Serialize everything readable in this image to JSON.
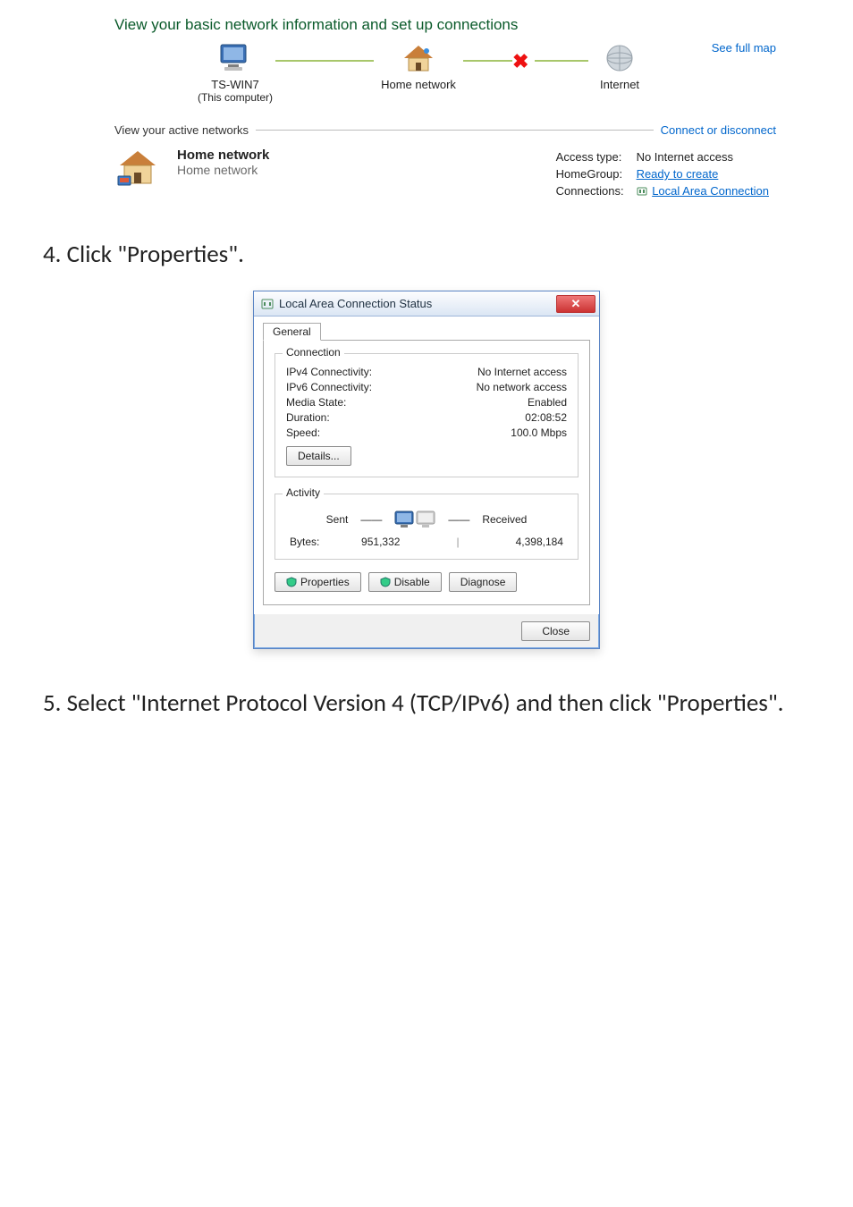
{
  "nsc": {
    "title": "View your basic network information and set up connections",
    "see_full_map": "See full map",
    "node_this_name": "TS-WIN7",
    "node_this_sub": "(This computer)",
    "node_home_label": "Home network",
    "node_internet_label": "Internet",
    "section_view_active": "View your active networks",
    "connect_disconnect": "Connect or disconnect",
    "home_network_name": "Home network",
    "home_network_type": "Home network",
    "access_type_label": "Access type:",
    "access_type_value": "No Internet access",
    "homegroup_label": "HomeGroup:",
    "homegroup_value": "Ready to create",
    "connections_label": "Connections:",
    "connections_value": "Local Area Connection"
  },
  "step4": "4. Click \"Properties\".",
  "dialog": {
    "title": "Local Area Connection Status",
    "tab_general": "General",
    "group_connection": "Connection",
    "ipv4_label": "IPv4 Connectivity:",
    "ipv4_value": "No Internet access",
    "ipv6_label": "IPv6 Connectivity:",
    "ipv6_value": "No network access",
    "media_label": "Media State:",
    "media_value": "Enabled",
    "duration_label": "Duration:",
    "duration_value": "02:08:52",
    "speed_label": "Speed:",
    "speed_value": "100.0 Mbps",
    "details_btn": "Details...",
    "group_activity": "Activity",
    "sent_label": "Sent",
    "received_label": "Received",
    "bytes_label": "Bytes:",
    "bytes_sent": "951,332",
    "bytes_recv": "4,398,184",
    "properties_btn": "Properties",
    "disable_btn": "Disable",
    "diagnose_btn": "Diagnose",
    "close_btn": "Close"
  },
  "step5": "5. Select \"Internet Protocol Version 4 (TCP/IPv6) and then click \"Properties\"."
}
